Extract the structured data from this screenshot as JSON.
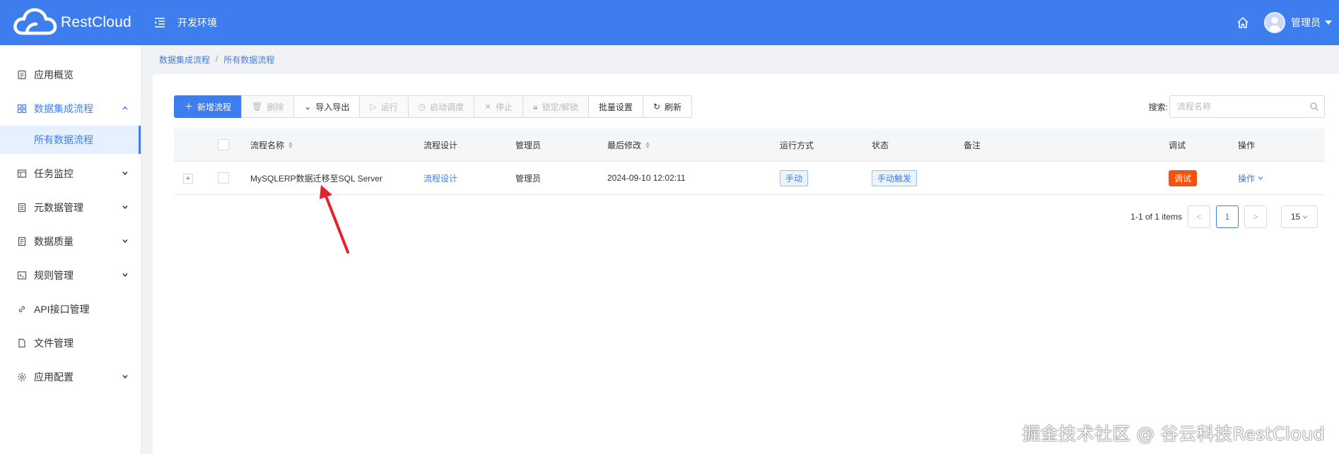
{
  "header": {
    "brand": "RestCloud",
    "env": "开发环境",
    "user": "管理员"
  },
  "sidebar": {
    "items": [
      {
        "label": "应用概览",
        "icon": "document-icon",
        "has_children": false
      },
      {
        "label": "数据集成流程",
        "icon": "grid-icon",
        "has_children": true,
        "expanded": true
      },
      {
        "label": "任务监控",
        "icon": "monitor-icon",
        "has_children": true
      },
      {
        "label": "元数据管理",
        "icon": "database-icon",
        "has_children": true
      },
      {
        "label": "数据质量",
        "icon": "quality-icon",
        "has_children": true
      },
      {
        "label": "规则管理",
        "icon": "terminal-icon",
        "has_children": true
      },
      {
        "label": "API接口管理",
        "icon": "link-icon",
        "has_children": false
      },
      {
        "label": "文件管理",
        "icon": "file-icon",
        "has_children": false
      },
      {
        "label": "应用配置",
        "icon": "gear-icon",
        "has_children": true
      }
    ],
    "active_sub": "所有数据流程"
  },
  "breadcrumb": {
    "parent": "数据集成流程",
    "separator": "/",
    "current": "所有数据流程"
  },
  "toolbar": {
    "add": "新增流程",
    "delete": "删除",
    "import_export": "导入导出",
    "run": "运行",
    "schedule": "启动调度",
    "stop": "停止",
    "lock": "锁定/解锁",
    "batch": "批量设置",
    "refresh": "刷新"
  },
  "search": {
    "label": "搜索:",
    "placeholder": "流程名称"
  },
  "table": {
    "columns": [
      "流程名称",
      "流程设计",
      "管理员",
      "最后修改",
      "运行方式",
      "状态",
      "备注",
      "调试",
      "操作"
    ],
    "rows": [
      {
        "name": "MySQLERP数据迁移至SQL Server",
        "design": "流程设计",
        "admin": "管理员",
        "modified": "2024-09-10 12:02:11",
        "run_mode": "手动",
        "status": "手动触发",
        "note": "",
        "debug": "调试",
        "action": "操作"
      }
    ]
  },
  "pagination": {
    "summary": "1-1 of 1 items",
    "prev": "<",
    "current": "1",
    "next": ">",
    "page_size": "15"
  },
  "watermark": "掘金技术社区 @ 谷云科技RestCloud",
  "colors": {
    "primary": "#3e7ded",
    "debug_tag": "#f4530f",
    "arrow": "#e8202a"
  }
}
